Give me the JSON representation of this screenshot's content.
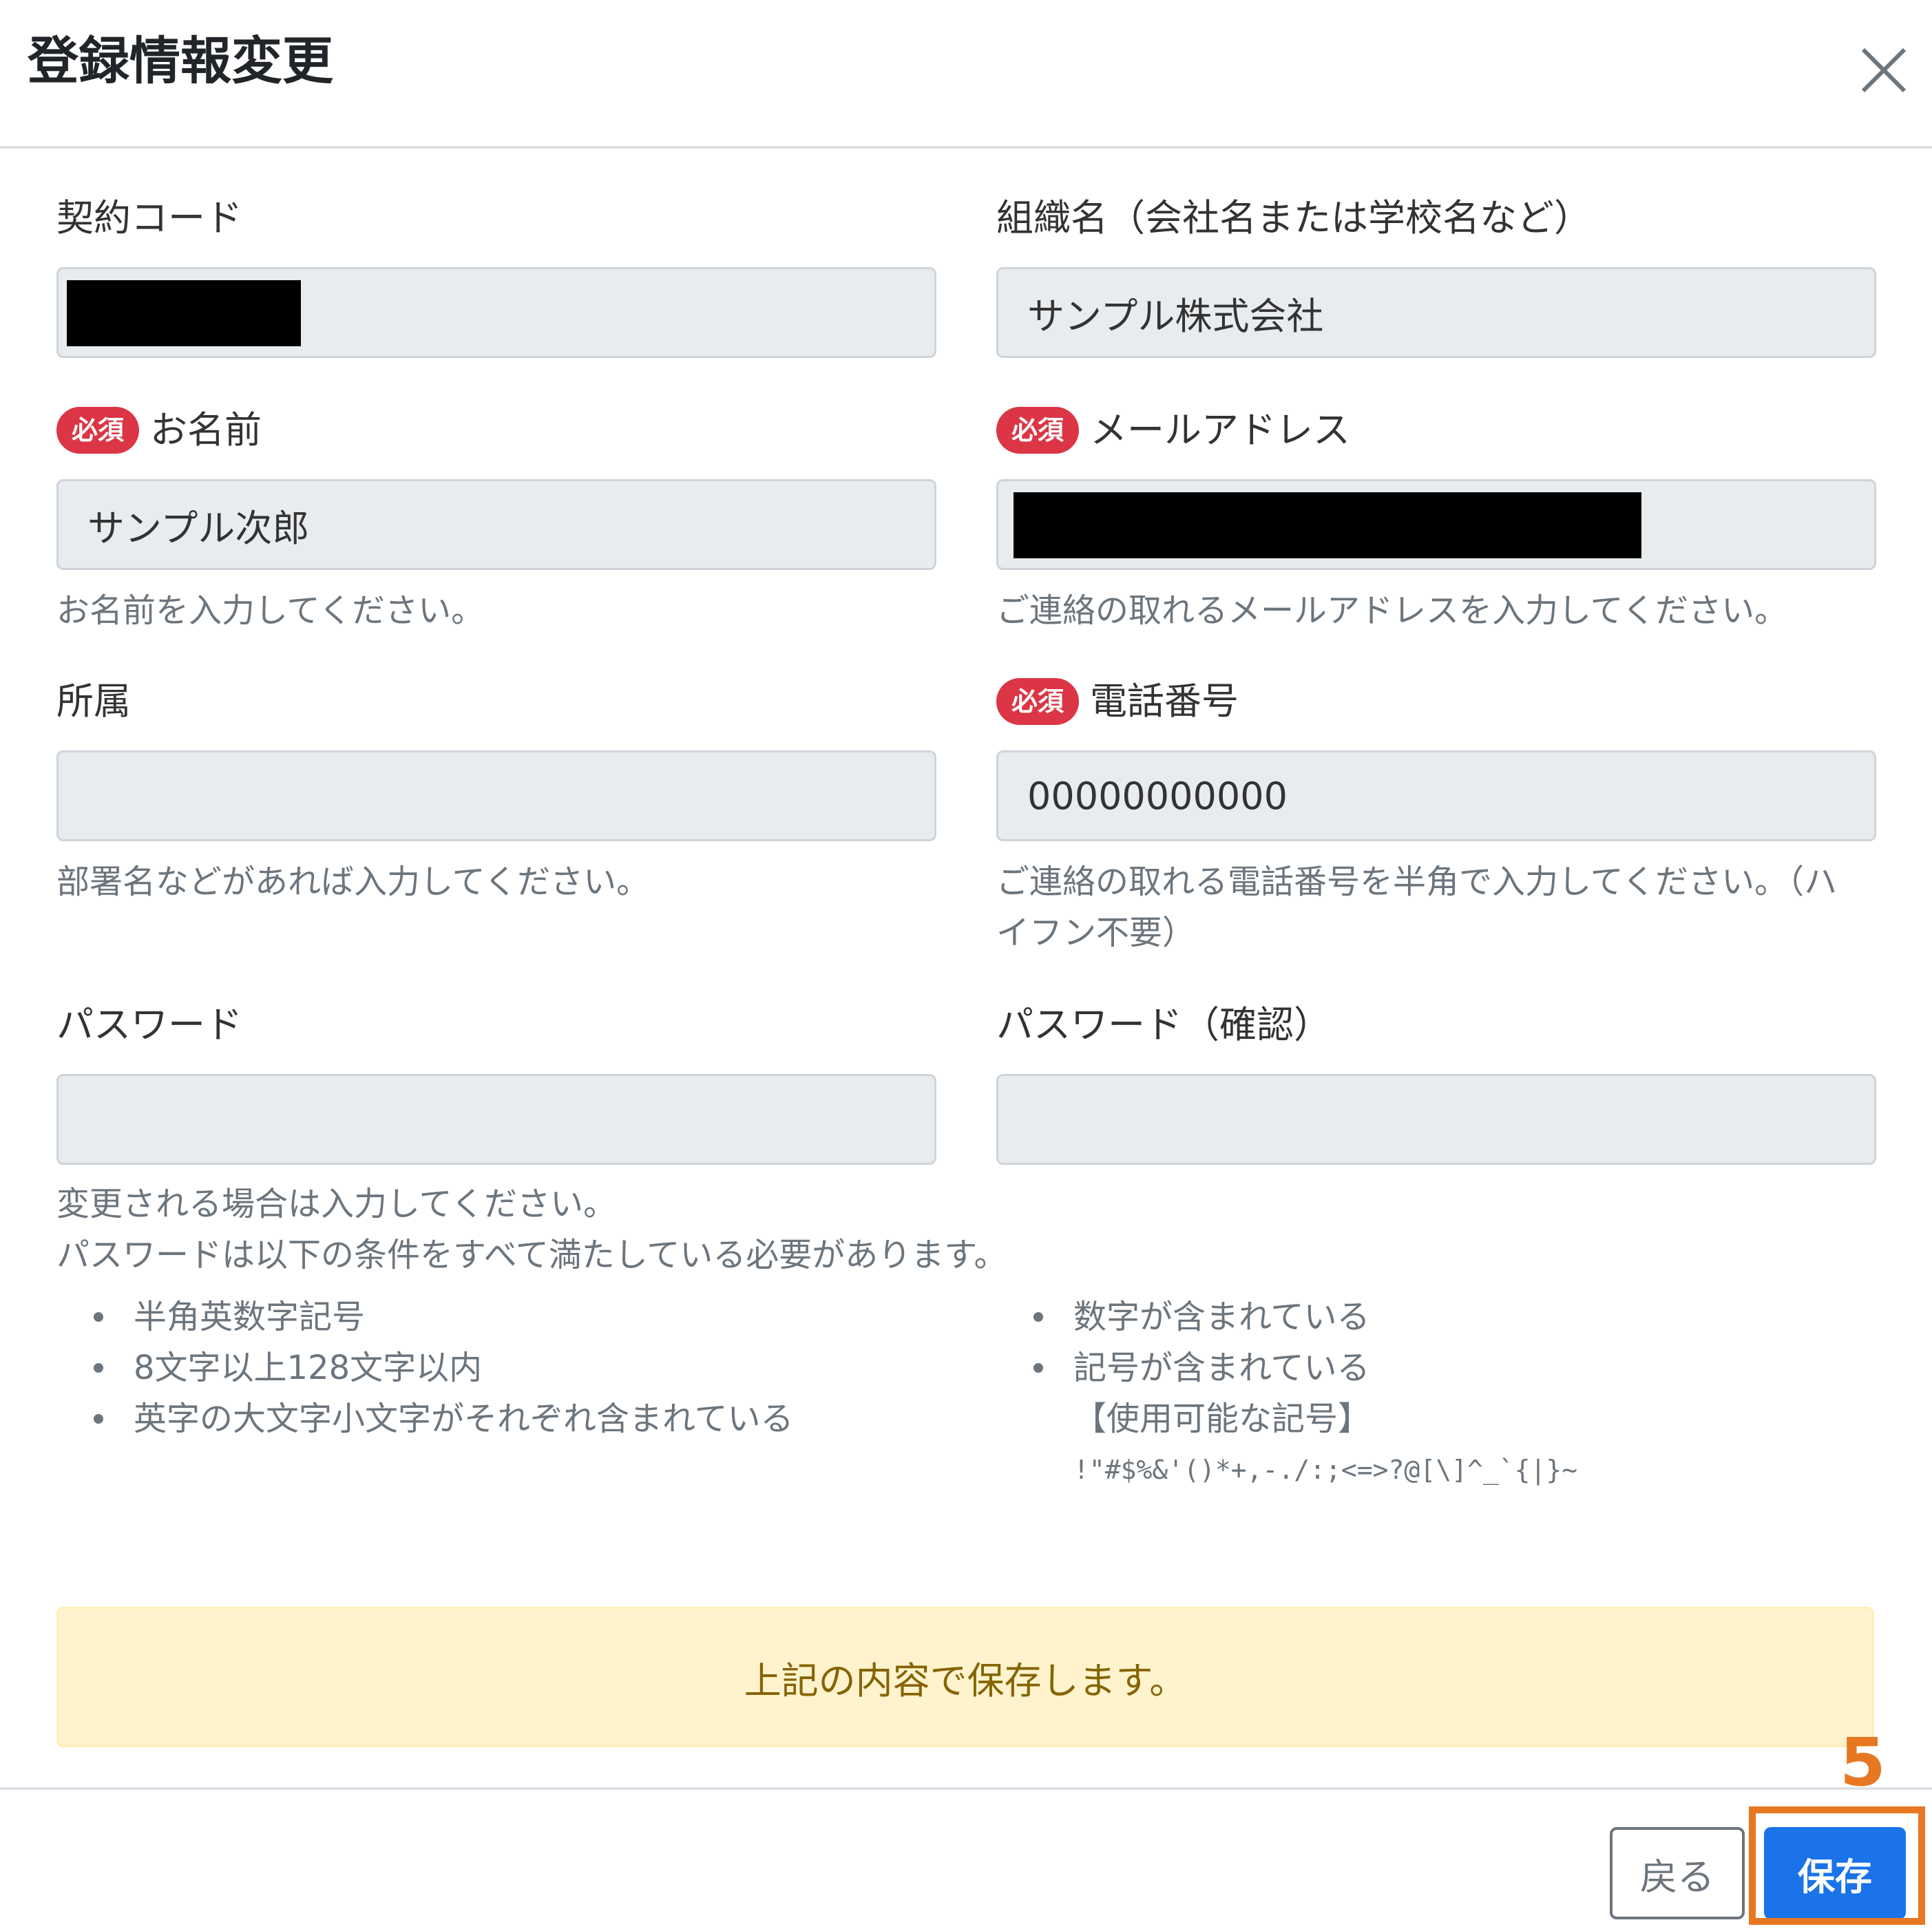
{
  "modal": {
    "title": "登録情報変更"
  },
  "badges": {
    "required": "必須"
  },
  "fields": {
    "contract_code": {
      "label": "契約コード",
      "value": ""
    },
    "organization": {
      "label": "組織名（会社名または学校名など）",
      "value": "サンプル株式会社"
    },
    "name": {
      "label": "お名前",
      "value": "サンプル次郎",
      "help": "お名前を入力してください。"
    },
    "email": {
      "label": "メールアドレス",
      "value": "",
      "help": "ご連絡の取れるメールアドレスを入力してください。"
    },
    "department": {
      "label": "所属",
      "value": "",
      "help": "部署名などがあれば入力してください。"
    },
    "phone": {
      "label": "電話番号",
      "value": "00000000000",
      "help": "ご連絡の取れる電話番号を半角で入力してください。（ハイフン不要）"
    },
    "password": {
      "label": "パスワード",
      "value": ""
    },
    "password_confirm": {
      "label": "パスワード（確認）",
      "value": ""
    }
  },
  "password_help": {
    "line1": "変更される場合は入力してください。",
    "line2": "パスワードは以下の条件をすべて満たしている必要があります。",
    "rules_left": [
      "半角英数字記号",
      "8文字以上128文字以内",
      "英字の大文字小文字がそれぞれ含まれている"
    ],
    "rules_right": [
      "数字が含まれている",
      "記号が含まれている"
    ],
    "symbols_label": "【使用可能な記号】",
    "symbols": "!\"#$%&'()*+,-./:;<=>?@[\\]^_`{|}~"
  },
  "notice": {
    "text": "上記の内容で保存します。"
  },
  "footer": {
    "back_label": "戻る",
    "save_label": "保存"
  },
  "annotation": {
    "step_number": "5",
    "color": "#e87722"
  },
  "colors": {
    "required_badge": "#dc3545",
    "primary": "#1a73e8",
    "notice_bg": "#fff3cd"
  }
}
